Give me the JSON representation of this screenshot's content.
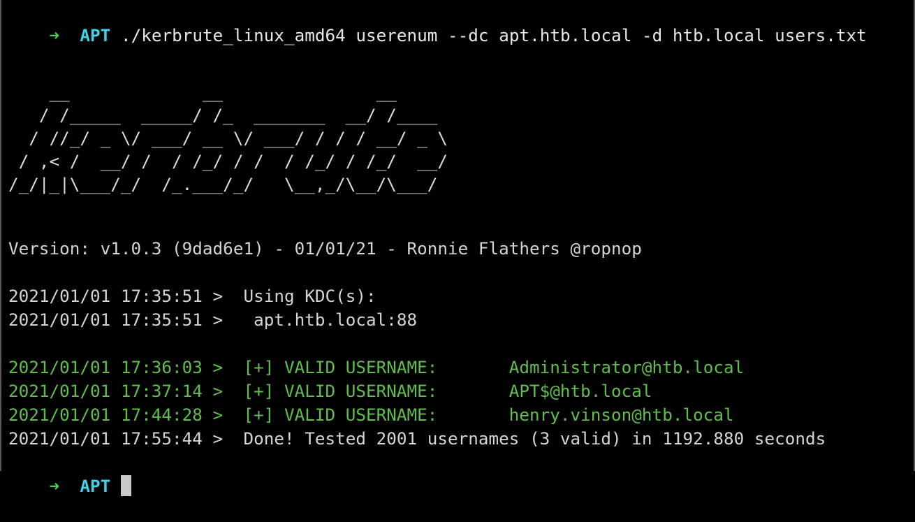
{
  "prompt": {
    "arrow": "➜",
    "name": "APT",
    "command": "./kerbrute_linux_amd64 userenum --dc apt.htb.local -d htb.local users.txt"
  },
  "banner": "    __             __               __\n   / /_____  _____/ /_  _______  __/ /____\n  / //_/ _ \\/ ___/ __ \\/ ___/ / / / __/ _ \\\n / ,< /  __/ /  / /_/ / /  / /_/ / /_/  __/\n/_/|_|\\___/_/  /_.___/_/   \\__,_/\\__/\\___/",
  "version_line": "Version: v1.0.3 (9dad6e1) - 01/01/21 - Ronnie Flathers @ropnop",
  "kdc_lines": [
    "2021/01/01 17:35:51 >  Using KDC(s):",
    "2021/01/01 17:35:51 >   apt.htb.local:88"
  ],
  "valid_lines": [
    "2021/01/01 17:36:03 >  [+] VALID USERNAME:       Administrator@htb.local",
    "2021/01/01 17:37:14 >  [+] VALID USERNAME:       APT$@htb.local",
    "2021/01/01 17:44:28 >  [+] VALID USERNAME:       henry.vinson@htb.local"
  ],
  "done_line": "2021/01/01 17:55:44 >  Done! Tested 2001 usernames (3 valid) in 1192.880 seconds",
  "final_prompt": {
    "arrow": "➜",
    "name": "APT"
  }
}
